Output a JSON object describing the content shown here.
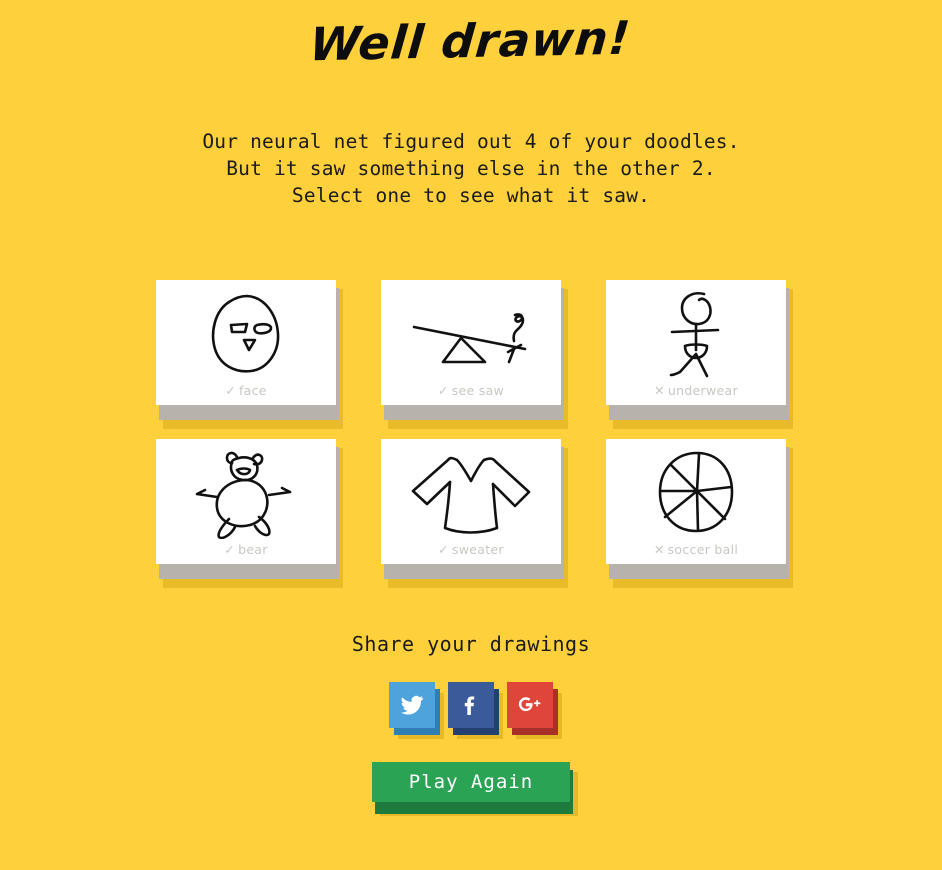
{
  "theme": {
    "background": "#fdd03c",
    "card_bg": "#ffffff",
    "card_plinth": "#b7b3ac",
    "drop_shadow": "#e8b927",
    "label_color": "#c9c7c2",
    "play_button_face": "#2aa355",
    "play_button_base": "#1f7a3d",
    "twitter_color": "#4fa3dd",
    "facebook_color": "#3b5a9a",
    "googleplus_color": "#e0453a"
  },
  "header": {
    "title": "Well drawn!"
  },
  "intro": {
    "line1": "Our neural net figured out 4 of your doodles.",
    "line2": "But it saw something else in the other 2.",
    "line3": "Select one to see what it saw."
  },
  "results": {
    "recognized_count": 4,
    "unrecognized_count": 2,
    "cards": [
      {
        "label": "face",
        "mark": "✓",
        "recognized": true,
        "art": "face-doodle"
      },
      {
        "label": "see saw",
        "mark": "✓",
        "recognized": true,
        "art": "see-saw-doodle"
      },
      {
        "label": "underwear",
        "mark": "✕",
        "recognized": false,
        "art": "underwear-doodle"
      },
      {
        "label": "bear",
        "mark": "✓",
        "recognized": true,
        "art": "bear-doodle"
      },
      {
        "label": "sweater",
        "mark": "✓",
        "recognized": true,
        "art": "sweater-doodle"
      },
      {
        "label": "soccer ball",
        "mark": "✕",
        "recognized": false,
        "art": "soccer-ball-doodle"
      }
    ]
  },
  "share": {
    "title": "Share your drawings",
    "buttons": [
      {
        "network": "twitter",
        "icon": "twitter-icon"
      },
      {
        "network": "facebook",
        "icon": "facebook-icon"
      },
      {
        "network": "googleplus",
        "icon": "google-plus-icon"
      }
    ]
  },
  "footer": {
    "play_again_label": "Play Again"
  }
}
